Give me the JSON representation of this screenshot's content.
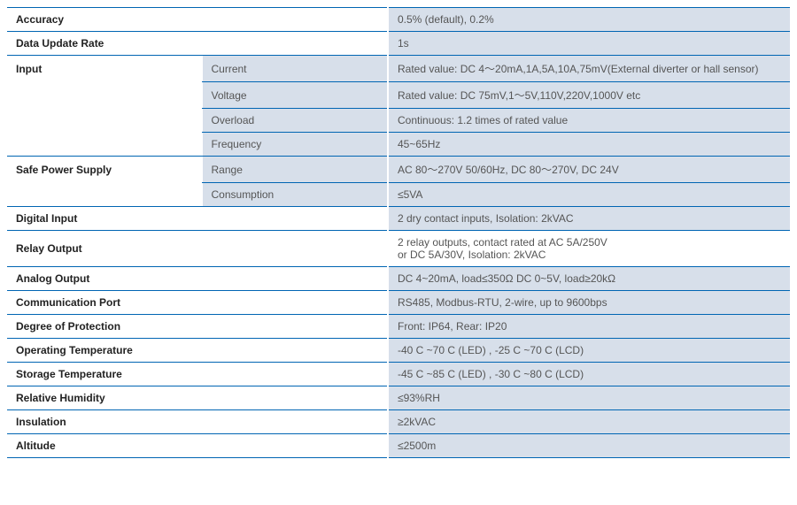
{
  "rows": {
    "accuracy_label": "Accuracy",
    "accuracy_value": "0.5% (default), 0.2%",
    "data_update_label": "Data Update Rate",
    "data_update_value": "1s",
    "input_label": "Input",
    "input_current_label": "Current",
    "input_current_value": "Rated value: DC 4～20mA,1A,5A,10A,75mV(External diverter or hall sensor)",
    "input_voltage_label": "Voltage",
    "input_voltage_value": "Rated value: DC 75mV,1～5V,110V,220V,1000V etc",
    "input_overload_label": "Overload",
    "input_overload_value": "Continuous: 1.2 times of rated value",
    "input_frequency_label": "Frequency",
    "input_frequency_value": "45~65Hz",
    "safe_power_label": "Safe Power Supply",
    "safe_power_range_label": "Range",
    "safe_power_range_value": "AC 80～270V 50/60Hz, DC 80～270V, DC 24V",
    "safe_power_consumption_label": "Consumption",
    "safe_power_consumption_value": "≤5VA",
    "digital_input_label": "Digital Input",
    "digital_input_value": "2 dry contact inputs, Isolation: 2kVAC",
    "relay_output_label": "Relay Output",
    "relay_output_value_line1": " 2 relay outputs, contact rated at AC 5A/250V",
    "relay_output_value_line2": "or DC 5A/30V,  Isolation: 2kVAC",
    "analog_output_label": "Analog Output",
    "analog_output_value": "DC 4~20mA, load≤350Ω   DC 0~5V, load≥20kΩ",
    "comm_port_label": "Communication Port",
    "comm_port_value": "RS485, Modbus-RTU, 2-wire, up to 9600bps",
    "degree_protection_label": "Degree of Protection",
    "degree_protection_value": "Front:  IP64, Rear: IP20",
    "operating_temp_label": "Operating Temperature",
    "operating_temp_value": "-40 C ~70 C (LED) ,  -25 C ~70 C (LCD)",
    "storage_temp_label": "Storage Temperature",
    "storage_temp_value": "-45 C ~85 C (LED) , -30 C ~80 C (LCD)",
    "relative_humidity_label": "Relative Humidity",
    "relative_humidity_value": "≤93%RH",
    "insulation_label": "Insulation",
    "insulation_value": "≥2kVAC",
    "altitude_label": "Altitude",
    "altitude_value": "≤2500m"
  }
}
